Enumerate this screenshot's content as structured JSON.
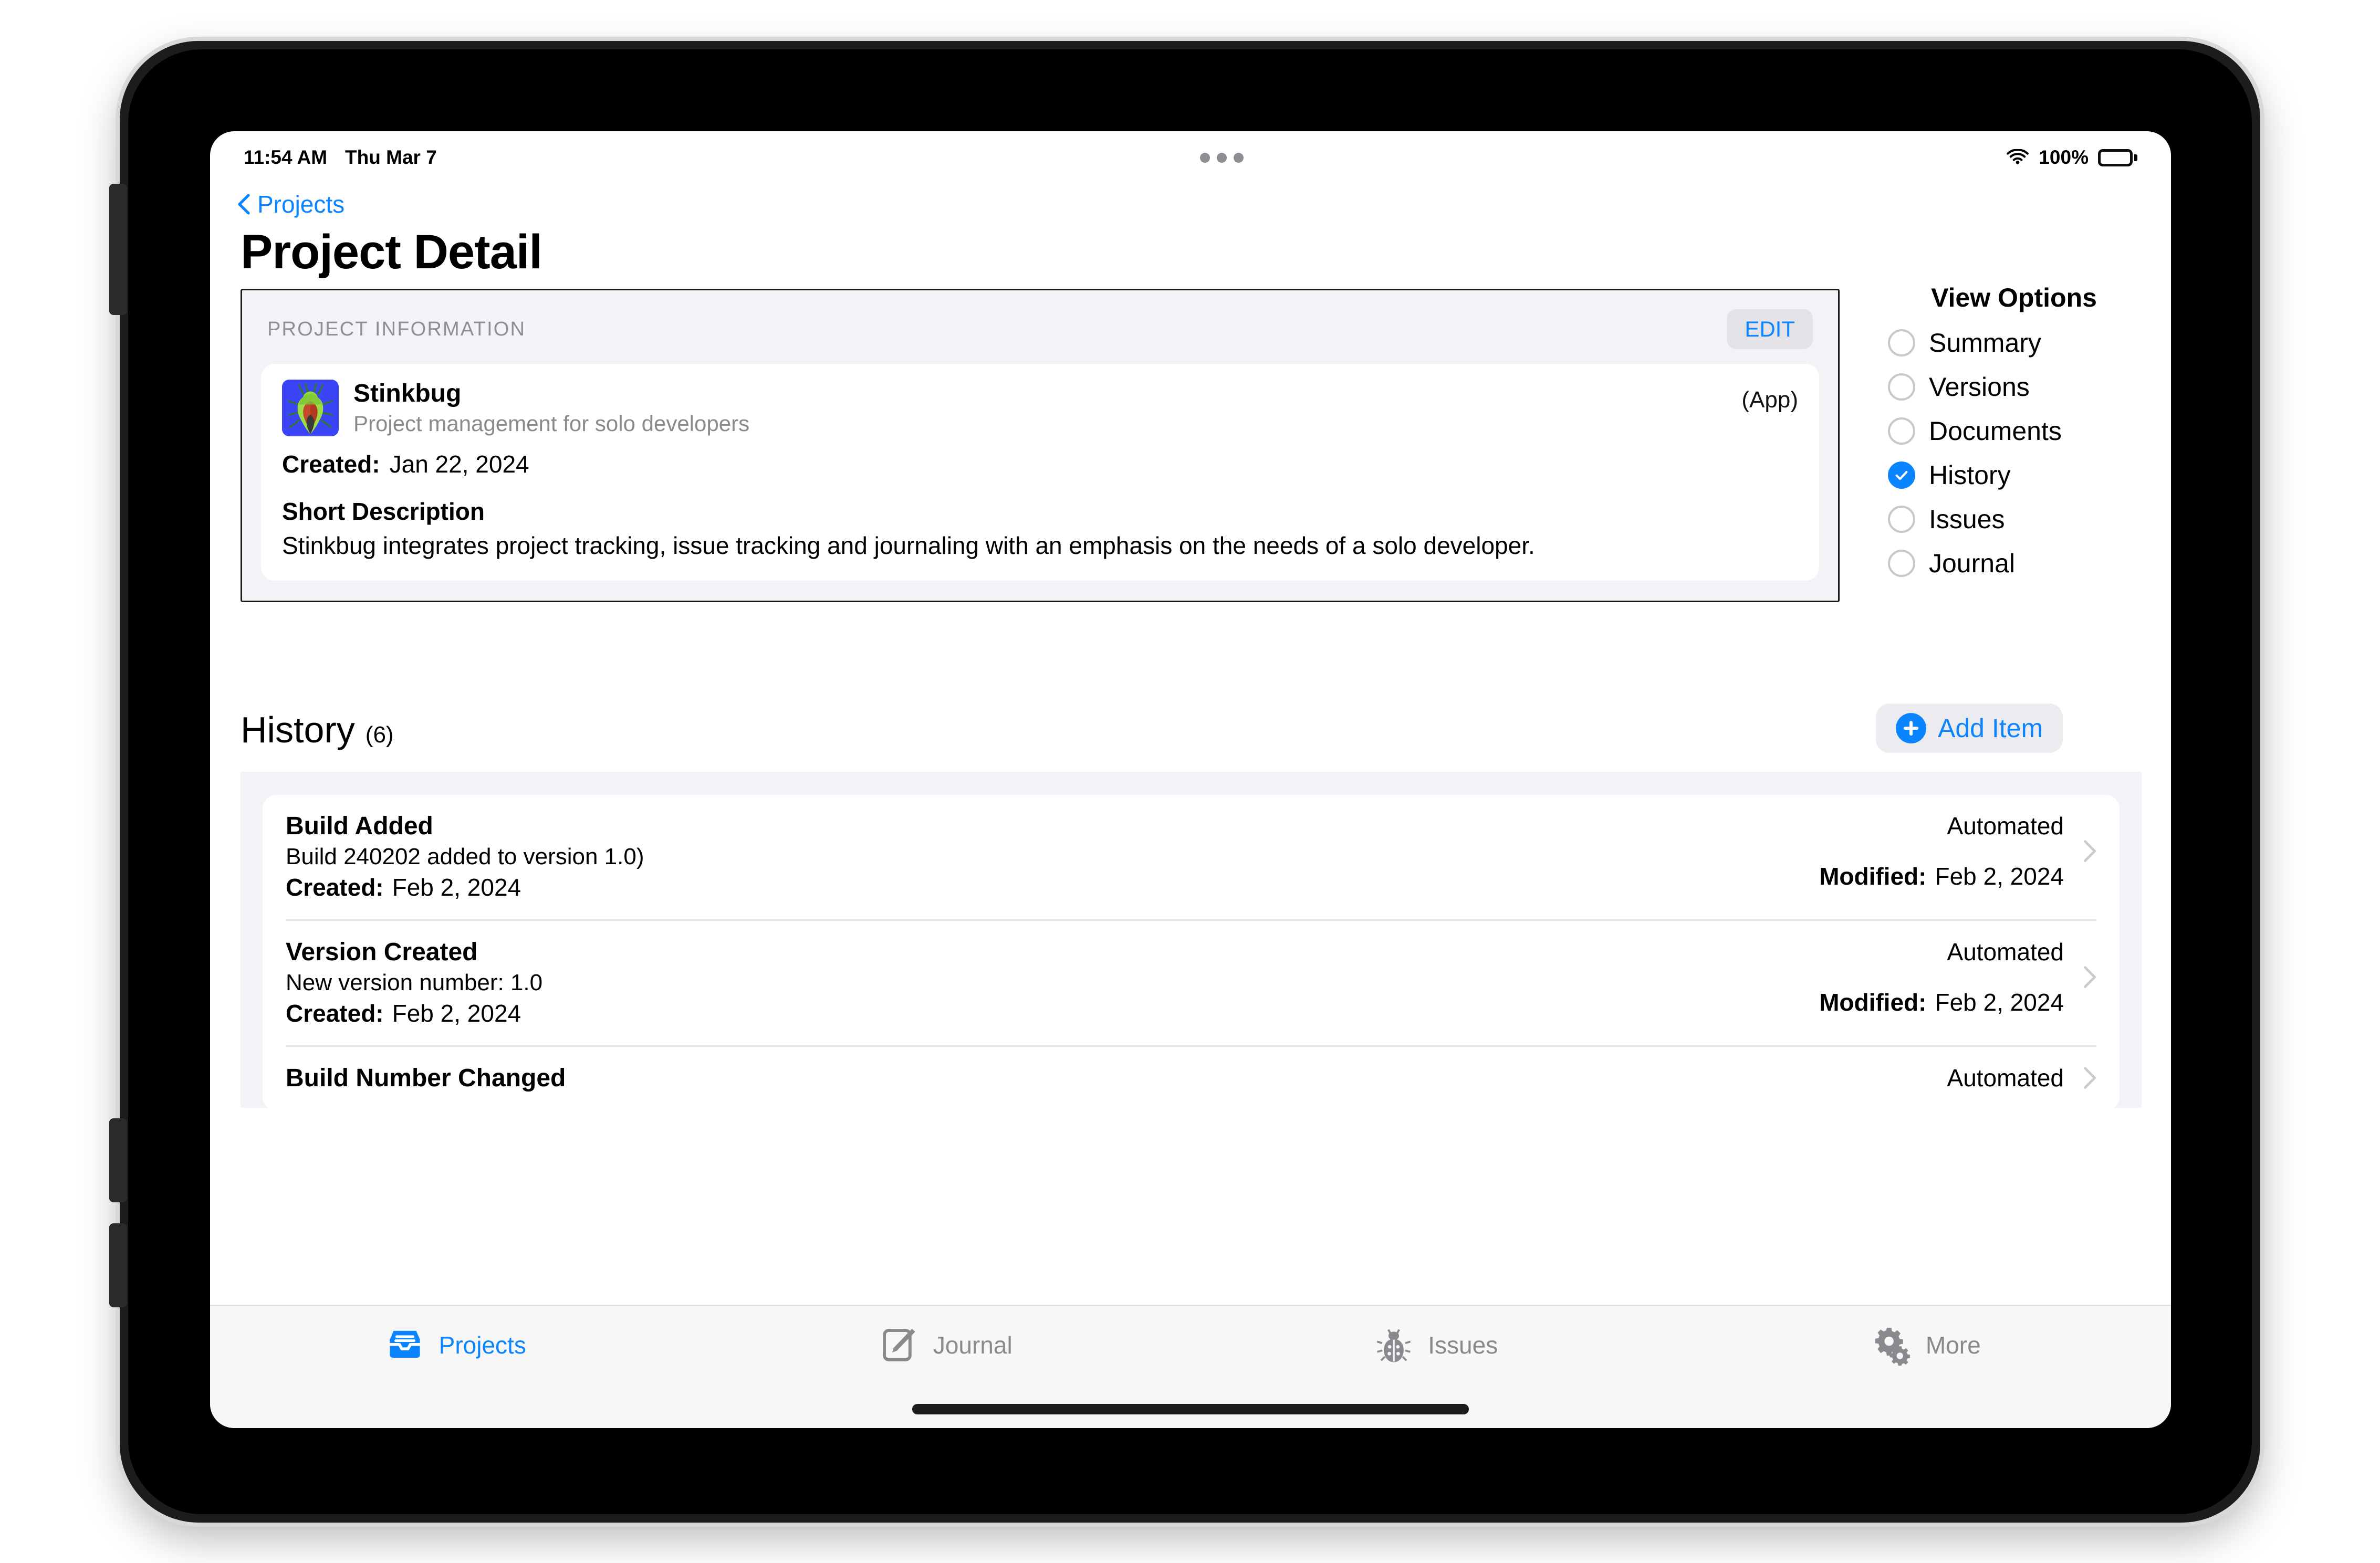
{
  "status_bar": {
    "time": "11:54 AM",
    "date": "Thu Mar 7",
    "battery_percent": "100%",
    "wifi_icon": "wifi-icon",
    "battery_icon": "battery-icon",
    "multitask_icon": "multitasking-dots-icon"
  },
  "nav": {
    "back_label": "Projects",
    "back_icon": "chevron-left-icon"
  },
  "page_title": "Project Detail",
  "info_panel": {
    "section_label": "PROJECT INFORMATION",
    "edit_label": "EDIT",
    "app_icon": "stinkbug-app-icon",
    "app_name": "Stinkbug",
    "app_tagline": "Project management for solo developers",
    "app_kind": "(App)",
    "created_key": "Created:",
    "created_value": "Jan 22, 2024",
    "description_title": "Short Description",
    "description_body": "Stinkbug integrates project tracking, issue tracking and journaling with an emphasis on the needs of a solo developer."
  },
  "view_options": {
    "title": "View Options",
    "selected": "History",
    "items": [
      {
        "label": "Summary",
        "selected": false
      },
      {
        "label": "Versions",
        "selected": false
      },
      {
        "label": "Documents",
        "selected": false
      },
      {
        "label": "History",
        "selected": true
      },
      {
        "label": "Issues",
        "selected": false
      },
      {
        "label": "Journal",
        "selected": false
      }
    ]
  },
  "history": {
    "title": "History",
    "count": "(6)",
    "add_item_label": "Add Item",
    "add_item_icon": "plus-circle-icon",
    "created_key": "Created:",
    "modified_key": "Modified:",
    "disclosure_icon": "chevron-right-icon",
    "rows": [
      {
        "title": "Build Added",
        "subtitle": "Build 240202 added to version 1.0)",
        "created": "Feb 2, 2024",
        "source": "Automated",
        "modified": "Feb 2, 2024"
      },
      {
        "title": "Version Created",
        "subtitle": "New version number: 1.0",
        "created": "Feb 2, 2024",
        "source": "Automated",
        "modified": "Feb 2, 2024"
      },
      {
        "title": "Build Number Changed",
        "subtitle": "",
        "created": "",
        "source": "Automated",
        "modified": ""
      }
    ]
  },
  "tab_bar": {
    "tabs": [
      {
        "label": "Projects",
        "icon": "tray-icon",
        "active": true
      },
      {
        "label": "Journal",
        "icon": "pencil-square-icon",
        "active": false
      },
      {
        "label": "Issues",
        "icon": "ladybug-icon",
        "active": false
      },
      {
        "label": "More",
        "icon": "gears-icon",
        "active": false
      }
    ]
  },
  "colors": {
    "accent": "#0a84ff",
    "panel_bg": "#f2f2f7",
    "muted_text": "#8e8e93",
    "app_icon_bg": "#3b44f6"
  }
}
